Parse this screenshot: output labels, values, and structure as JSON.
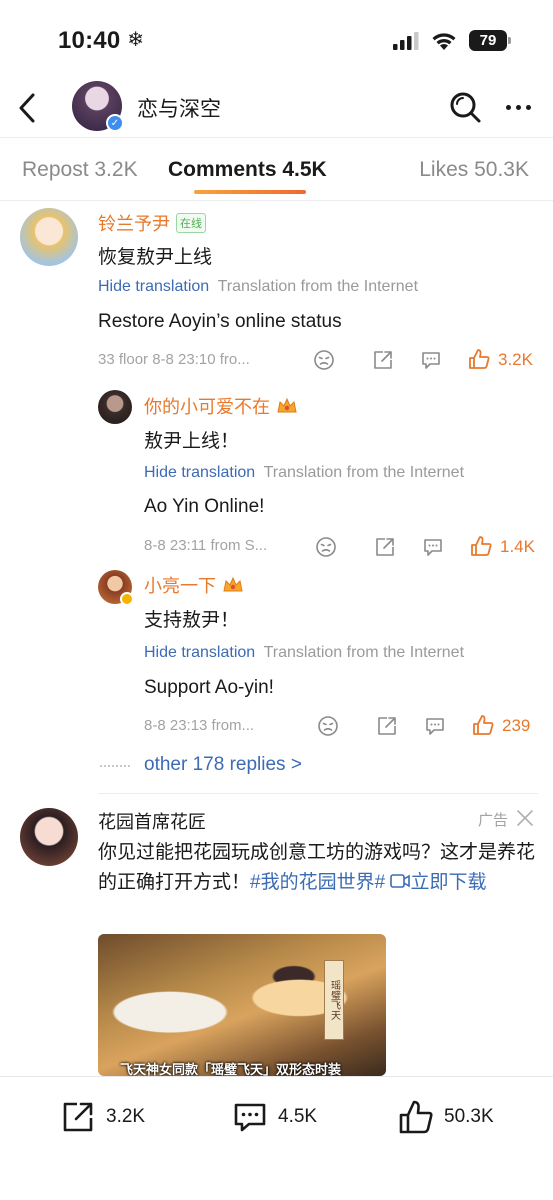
{
  "status_bar": {
    "time": "10:40",
    "battery": "79",
    "icons": [
      "snowflake-icon",
      "cellular-signal-icon",
      "wifi-icon",
      "battery-icon"
    ]
  },
  "header": {
    "title": "恋与深空",
    "icons": [
      "back-arrow-icon",
      "verified-icon",
      "search-icon",
      "more-icon"
    ]
  },
  "tabs": [
    {
      "label": "Repost 3.2K",
      "active": false
    },
    {
      "label": "Comments 4.5K",
      "active": true
    },
    {
      "label": "Likes 50.3K",
      "active": false
    }
  ],
  "colors": {
    "accent_orange": "#e8792c",
    "link_blue": "#3c6bb5",
    "meta_gray": "#a3a3a3"
  },
  "comment": {
    "username": "铃兰予尹",
    "online_tag": "在线",
    "text": "恢复敖尹上线",
    "hide_translation": "Hide translation",
    "translation_source": "Translation from the Internet",
    "translation": "Restore Aoyin’s online status",
    "meta": "33 floor 8-8 23:10  fro...",
    "likes": "3.2K",
    "replies": [
      {
        "username": "你的小可爱不在",
        "text": "敖尹上线！",
        "hide_translation": "Hide translation",
        "translation_source": "Translation from the Internet",
        "translation": "Ao Yin Online!",
        "meta": "8-8 23:11  from S...",
        "likes": "1.4K"
      },
      {
        "username": "小亮一下",
        "text": "支持敖尹！",
        "hide_translation": "Hide translation",
        "translation_source": "Translation from the Internet",
        "translation": "Support Ao-yin!",
        "meta": "8-8 23:13  from...",
        "likes": "239"
      }
    ],
    "more_replies": "other 178 replies >"
  },
  "ad": {
    "name": "花园首席花匠",
    "ad_label": "广告",
    "text_main": "你见过能把花园玩成创意工坊的游戏吗？这才是养花的正确打开方式！",
    "hashtag": "#我的花园世界#",
    "link": "立即下载",
    "image_caption": "飞天神女同款「瑶璧飞天」双形态时装",
    "image_side_text": "瑶璧飞天"
  },
  "bottom_bar": {
    "repost_count": "3.2K",
    "comment_count": "4.5K",
    "like_count": "50.3K"
  }
}
